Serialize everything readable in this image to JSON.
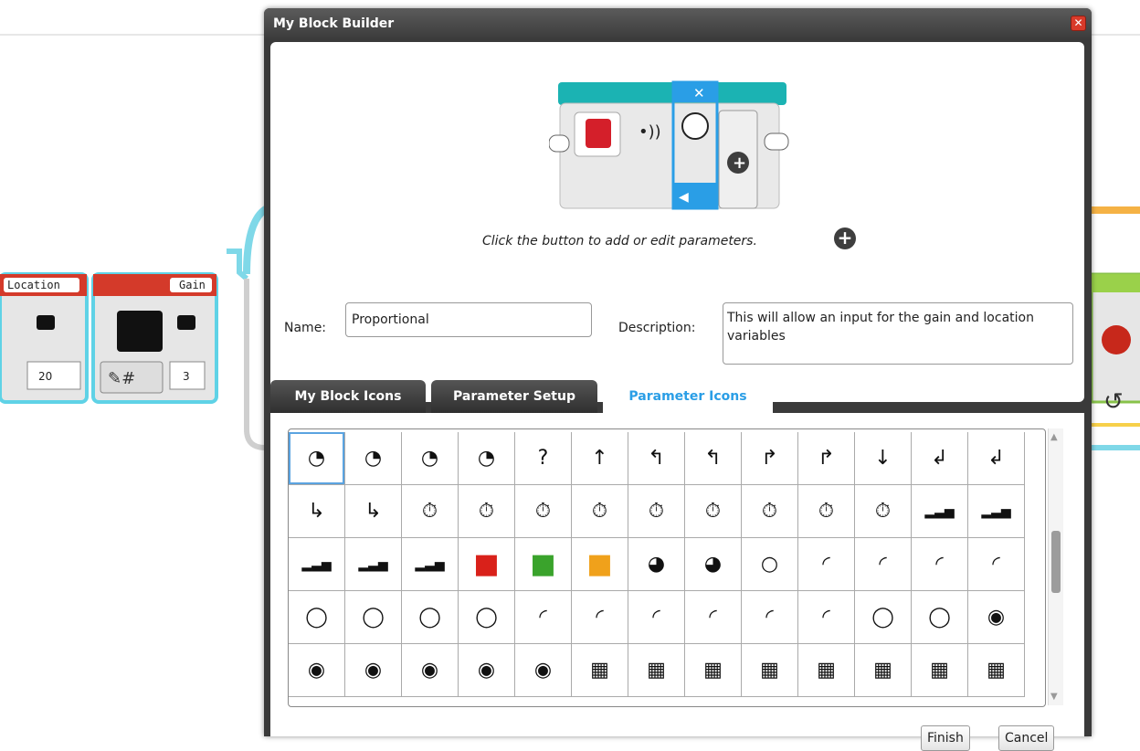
{
  "canvas": {
    "location_block_label": "Location",
    "location_value": "20",
    "gain_block_label": "Gain",
    "gain_value": "3"
  },
  "dialog": {
    "title": "My Block Builder",
    "hint": "Click the button to add or edit parameters.",
    "name_label": "Name:",
    "name_value": "Proportional",
    "description_label": "Description:",
    "description_value": "This will allow an input for the gain and location variables",
    "tabs": [
      {
        "label": "My Block Icons",
        "active": false
      },
      {
        "label": "Parameter Setup",
        "active": false
      },
      {
        "label": "Parameter Icons",
        "active": true
      }
    ],
    "buttons": {
      "finish": "Finish",
      "cancel": "Cancel"
    }
  },
  "icon_grid": {
    "rows": [
      [
        "speedometer-icon",
        "speedometer-icon",
        "speedometer-icon",
        "speedometer-icon",
        "help-speedometer-icon",
        "arrow-up-icon",
        "arrow-turn-left-icon",
        "arrow-turn-left-icon",
        "arrow-turn-right-icon",
        "arrow-turn-right-icon",
        "arrow-down-icon",
        "arrow-down-left-icon",
        "arrow-down-left-icon"
      ],
      [
        "arrow-down-right-icon",
        "arrow-down-right-icon",
        "timer-icon",
        "timer-1-icon",
        "timer-2-icon",
        "timer-3-icon",
        "timer-4-icon",
        "timer-5-icon",
        "timer-6-icon",
        "timer-7-icon",
        "timer-8-icon",
        "signal-bars-icon",
        "signal-bars-icon"
      ],
      [
        "signal-bars-icon",
        "signal-bars-icon",
        "signal-bars-icon",
        "red-square-icon",
        "green-square-icon",
        "orange-square-icon",
        "number-dial-icon",
        "degrees-dial-icon",
        "circle-icon",
        "arc-icon",
        "arc-icon",
        "arc-icon",
        "arc-icon"
      ],
      [
        "ring-icon",
        "ring-icon",
        "ring-icon",
        "ring-icon",
        "arc-light-icon",
        "arc-light-icon",
        "arc-light-icon",
        "arc-light-icon",
        "arc-light-icon",
        "arc-light-icon",
        "ring-icon",
        "ring-icon",
        "motor-icon"
      ],
      [
        "motor-icon",
        "motor-icon",
        "motor-icon",
        "motor-icon",
        "motor-icon",
        "display-icon",
        "display-icon",
        "display-icon",
        "display-icon",
        "display-icon",
        "display-icon",
        "display-icon",
        "display-icon"
      ]
    ],
    "glyphs": {
      "speedometer-icon": "◔",
      "help-speedometer-icon": "?",
      "arrow-up-icon": "↑",
      "arrow-turn-left-icon": "↰",
      "arrow-turn-right-icon": "↱",
      "arrow-down-icon": "↓",
      "arrow-down-left-icon": "↲",
      "arrow-down-right-icon": "↳",
      "timer-icon": "⏱",
      "timer-1-icon": "⏱",
      "timer-2-icon": "⏱",
      "timer-3-icon": "⏱",
      "timer-4-icon": "⏱",
      "timer-5-icon": "⏱",
      "timer-6-icon": "⏱",
      "timer-7-icon": "⏱",
      "timer-8-icon": "⏱",
      "signal-bars-icon": "▂▃▅",
      "red-square-icon": "■",
      "green-square-icon": "■",
      "orange-square-icon": "■",
      "number-dial-icon": "◕",
      "degrees-dial-icon": "◕",
      "circle-icon": "○",
      "arc-icon": "◜",
      "ring-icon": "◯",
      "arc-light-icon": "◜",
      "motor-icon": "◉",
      "display-icon": "▦"
    },
    "colors": {
      "red-square-icon": "#d9211a",
      "green-square-icon": "#3aa32c",
      "orange-square-icon": "#f0a11b"
    }
  }
}
